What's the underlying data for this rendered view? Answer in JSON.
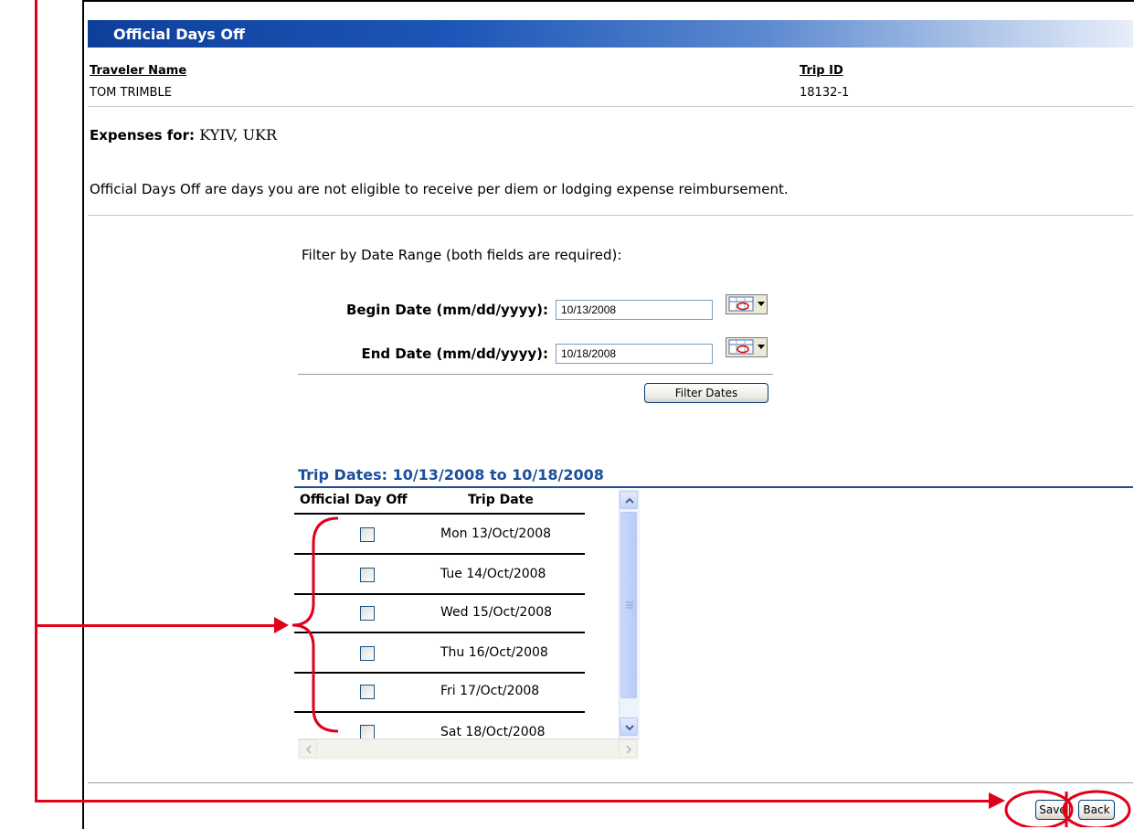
{
  "header": {
    "title": "Official Days Off"
  },
  "traveler": {
    "name_label": "Traveler Name",
    "name": "TOM TRIMBLE",
    "trip_id_label": "Trip ID",
    "trip_id": "18132-1"
  },
  "expenses": {
    "label": "Expenses for:",
    "location": "KYIV, UKR"
  },
  "description": "Official Days Off are days you are not eligible to receive per diem or lodging expense reimbursement.",
  "filter": {
    "title": "Filter by Date Range (both fields are required):",
    "begin_label": "Begin Date (mm/dd/yyyy):",
    "begin_value": "10/13/2008",
    "end_label": "End Date (mm/dd/yyyy):",
    "end_value": "10/18/2008",
    "button": "Filter Dates"
  },
  "trip_dates": {
    "heading": "Trip Dates: 10/13/2008 to 10/18/2008",
    "col_off": "Official Day Off",
    "col_date": "Trip Date",
    "rows": [
      {
        "date": "Mon 13/Oct/2008",
        "checked": false
      },
      {
        "date": "Tue 14/Oct/2008",
        "checked": false
      },
      {
        "date": "Wed 15/Oct/2008",
        "checked": false
      },
      {
        "date": "Thu 16/Oct/2008",
        "checked": false
      },
      {
        "date": "Fri 17/Oct/2008",
        "checked": false
      },
      {
        "date": "Sat 18/Oct/2008",
        "checked": false
      }
    ]
  },
  "actions": {
    "save": "Save",
    "back": "Back"
  },
  "colors": {
    "header_blue": "#0e3f9a",
    "annotation_red": "#e0001a",
    "trip_dates_blue": "#1d4e9c"
  }
}
